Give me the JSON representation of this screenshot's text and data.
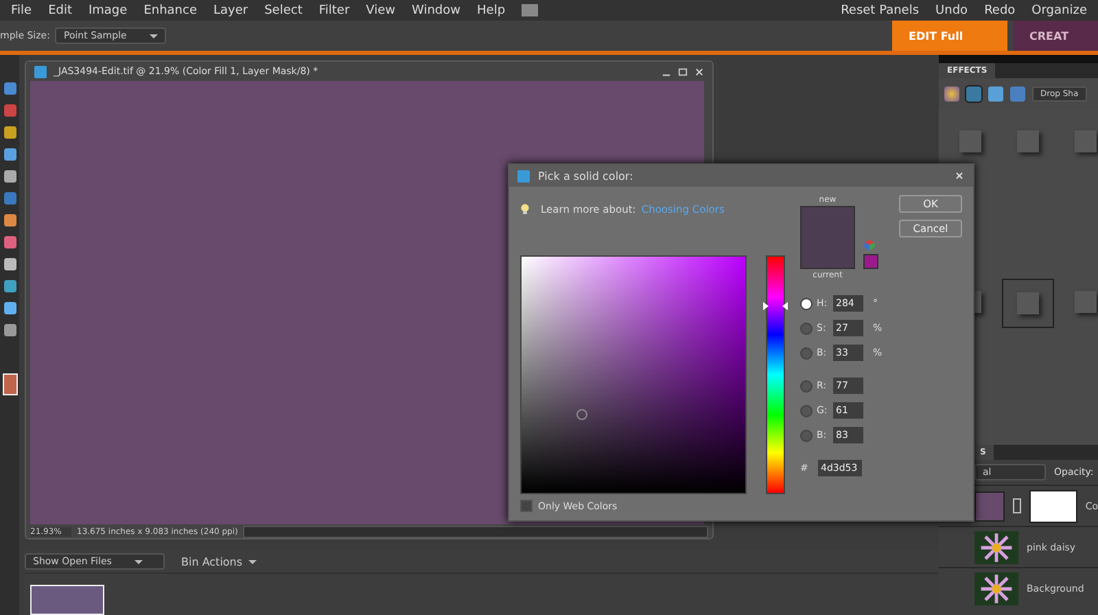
{
  "menu_bar": {
    "items": [
      "File",
      "Edit",
      "Image",
      "Enhance",
      "Layer",
      "Select",
      "Filter",
      "View",
      "Window",
      "Help"
    ],
    "buttons": [
      {
        "label": "Reset Panels"
      },
      {
        "label": "Undo"
      },
      {
        "label": "Redo"
      },
      {
        "label": "Organize"
      }
    ]
  },
  "options_bar": {
    "sample_size_label": "mple Size:",
    "sample_size_value": "Point Sample"
  },
  "mode_tabs": [
    {
      "label": "EDIT Full",
      "selected": true
    },
    {
      "label": "CREAT",
      "selected": false
    }
  ],
  "document": {
    "title": "_JAS3494-Edit.tif @ 21.9% (Color Fill 1, Layer Mask/8) *",
    "zoom": "21.93%",
    "dimensions": "13.675 inches x 9.083 inches (240 ppi)"
  },
  "bin": {
    "dropdown": "Show Open Files",
    "actions": "Bin Actions"
  },
  "effects_panel": {
    "tab": "EFFECTS",
    "dropdown": "Drop Sha"
  },
  "layers_panel": {
    "tab": "S",
    "blend_mode": "al",
    "opacity_label": "Opacity:",
    "layers": [
      {
        "kind": "fill",
        "name": "Co"
      },
      {
        "kind": "image",
        "name": "pink daisy"
      },
      {
        "kind": "image",
        "name": "Background"
      }
    ]
  },
  "color_picker": {
    "title": "Pick a solid color:",
    "learn_more": "Learn more about:",
    "link": "Choosing Colors",
    "new_label": "new",
    "current_label": "current",
    "ok": "OK",
    "cancel": "Cancel",
    "fields": [
      {
        "label": "H:",
        "value": "284",
        "unit": "°",
        "selected": true
      },
      {
        "label": "S:",
        "value": "27",
        "unit": "%",
        "selected": false
      },
      {
        "label": "B:",
        "value": "33",
        "unit": "%",
        "selected": false
      },
      {
        "label": "R:",
        "value": "77",
        "selected": false
      },
      {
        "label": "G:",
        "value": "61",
        "selected": false
      },
      {
        "label": "B:",
        "value": "83",
        "selected": false
      }
    ],
    "hex_label": "#",
    "hex": "4d3d53",
    "only_web_colors": {
      "label": "Only Web Colors",
      "checked": false
    }
  }
}
